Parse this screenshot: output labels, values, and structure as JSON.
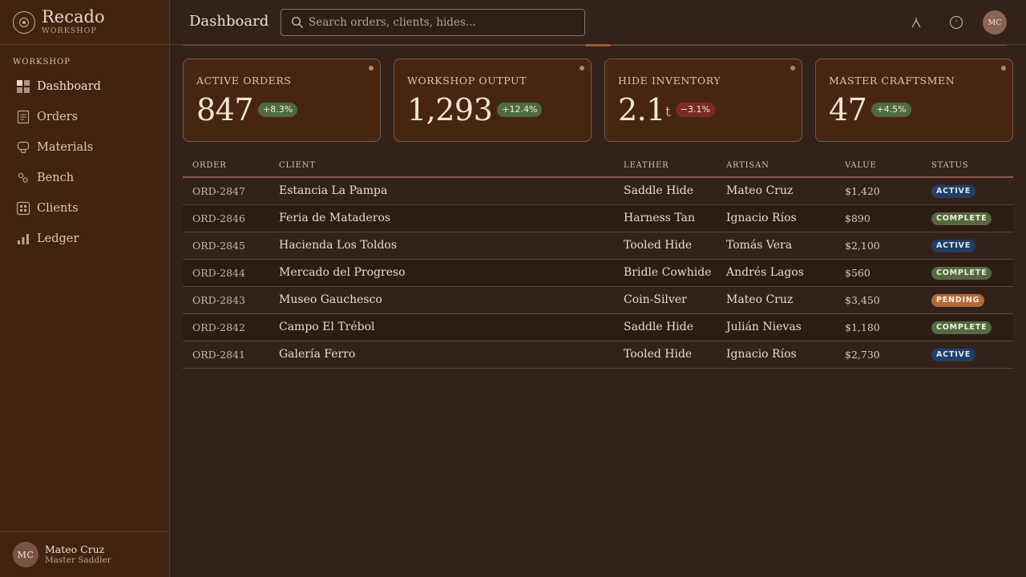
{
  "app": {
    "name": "Recado",
    "subtitle": "WORKSHOP"
  },
  "sidebar": {
    "section_label": "WORKSHOP",
    "items": [
      {
        "label": "Dashboard",
        "icon": "dashboard-grid-icon",
        "active": true
      },
      {
        "label": "Orders",
        "icon": "document-icon"
      },
      {
        "label": "Materials",
        "icon": "hide-icon"
      },
      {
        "label": "Bench",
        "icon": "tools-icon"
      },
      {
        "label": "Clients",
        "icon": "clients-grid-icon"
      },
      {
        "label": "Ledger",
        "icon": "bar-chart-icon"
      }
    ],
    "user": {
      "initials": "MC",
      "name": "Mateo Cruz",
      "role": "Master Saddler"
    }
  },
  "header": {
    "title": "Dashboard",
    "search_placeholder": "Search orders, clients, hides...",
    "avatar_initials": "MC",
    "icons": [
      "awl-icon",
      "help-circle-icon"
    ]
  },
  "kpis": [
    {
      "label": "ACTIVE ORDERS",
      "value": "847",
      "unit": "",
      "delta": "+8.3%",
      "trend": "up"
    },
    {
      "label": "WORKSHOP OUTPUT",
      "value": "1,293",
      "unit": "",
      "delta": "+12.4%",
      "trend": "up"
    },
    {
      "label": "HIDE INVENTORY",
      "value": "2.1",
      "unit": "t",
      "delta": "−3.1%",
      "trend": "down"
    },
    {
      "label": "MASTER CRAFTSMEN",
      "value": "47",
      "unit": "",
      "delta": "+4.5%",
      "trend": "up"
    }
  ],
  "table": {
    "columns": [
      "ORDER",
      "CLIENT",
      "LEATHER",
      "ARTISAN",
      "VALUE",
      "STATUS"
    ],
    "rows": [
      {
        "order": "ORD-2847",
        "client": "Estancia La Pampa",
        "leather": "Saddle Hide",
        "artisan": "Mateo Cruz",
        "value": "$1,420",
        "status": "ACTIVE"
      },
      {
        "order": "ORD-2846",
        "client": "Feria de Mataderos",
        "leather": "Harness Tan",
        "artisan": "Ignacio Ríos",
        "value": "$890",
        "status": "COMPLETE"
      },
      {
        "order": "ORD-2845",
        "client": "Hacienda Los Toldos",
        "leather": "Tooled Hide",
        "artisan": "Tomás Vera",
        "value": "$2,100",
        "status": "ACTIVE"
      },
      {
        "order": "ORD-2844",
        "client": "Mercado del Progreso",
        "leather": "Bridle Cowhide",
        "artisan": "Andrés Lagos",
        "value": "$560",
        "status": "COMPLETE"
      },
      {
        "order": "ORD-2843",
        "client": "Museo Gauchesco",
        "leather": "Coin-Silver",
        "artisan": "Mateo Cruz",
        "value": "$3,450",
        "status": "PENDING"
      },
      {
        "order": "ORD-2842",
        "client": "Campo El Trébol",
        "leather": "Saddle Hide",
        "artisan": "Julián Nievas",
        "value": "$1,180",
        "status": "COMPLETE"
      },
      {
        "order": "ORD-2841",
        "client": "Galería Ferro",
        "leather": "Tooled Hide",
        "artisan": "Ignacio Ríos",
        "value": "$2,730",
        "status": "ACTIVE"
      }
    ]
  },
  "colors": {
    "status_active": "#213f66",
    "status_complete": "#55693e",
    "status_pending": "#b26a3c",
    "trend_up": "#4f6a3b",
    "trend_down": "#7a2b22"
  }
}
